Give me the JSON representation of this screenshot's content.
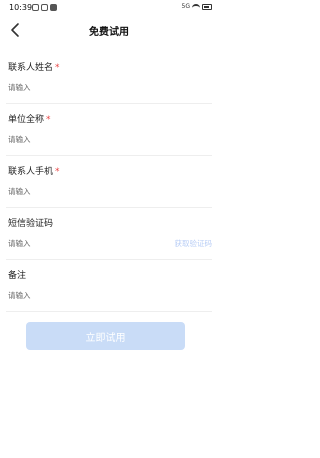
{
  "status": {
    "time": "10:39",
    "network": "5G",
    "battery": ""
  },
  "nav": {
    "title": "免费试用",
    "back_icon": "chevron-left-icon"
  },
  "form": {
    "fields": [
      {
        "label": "联系人姓名",
        "required_mark": "*",
        "placeholder": "请输入",
        "value": ""
      },
      {
        "label": "单位全称",
        "required_mark": "*",
        "placeholder": "请输入",
        "value": ""
      },
      {
        "label": "联系人手机",
        "required_mark": "*",
        "placeholder": "请输入",
        "value": ""
      },
      {
        "label": "短信验证码",
        "placeholder": "请输入",
        "value": "",
        "action": "获取验证码"
      },
      {
        "label": "备注",
        "placeholder": "请输入",
        "value": ""
      }
    ],
    "submit_label": "立即试用"
  },
  "colors": {
    "primary_disabled": "#c9dcf7",
    "required": "#e84545",
    "link_disabled": "#b9cef6"
  }
}
